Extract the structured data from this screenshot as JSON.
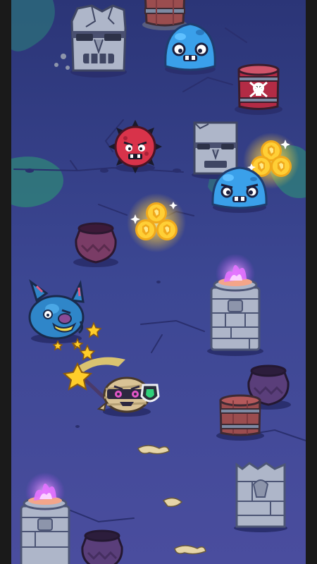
{
  "screen": {
    "type": "game-scene",
    "theme": "night-graveyard",
    "colors": {
      "side_border": "#1a1a1a",
      "ground": "#3f4a96",
      "ground_dark": "#2c3577",
      "moss": "#2f7d7a",
      "stone": "#aab2c5",
      "stone_dark": "#5c6584",
      "barrel": "#9b4d4f",
      "coin": "#ffc933",
      "flame": "#e472ff",
      "slime": "#3aa0ea",
      "spiky": "#d8334a",
      "bat": "#2f86c9",
      "mummy": "#d9c396",
      "star": "#ffcd2a"
    }
  },
  "hero": {
    "character": "mummy",
    "weapon": "star-wand",
    "shield": "green-gem-shield",
    "action": "swinging"
  },
  "enemies": [
    {
      "kind": "stone-tiki",
      "state": "cracked"
    },
    {
      "kind": "blue-slime"
    },
    {
      "kind": "spiky-red-ball"
    },
    {
      "kind": "stone-tiki"
    },
    {
      "kind": "blue-slime"
    },
    {
      "kind": "blue-bat",
      "state": "stunned"
    }
  ],
  "pickups": [
    {
      "kind": "gold-coin-cluster",
      "count": 3
    },
    {
      "kind": "gold-coin-cluster",
      "count": 3
    }
  ],
  "obstacles": [
    {
      "kind": "barrel"
    },
    {
      "kind": "barrel",
      "mark": "skull-and-crossbones"
    },
    {
      "kind": "barrel"
    },
    {
      "kind": "pot"
    },
    {
      "kind": "pot"
    },
    {
      "kind": "pot"
    },
    {
      "kind": "stone-pillar-with-brazier"
    },
    {
      "kind": "stone-pillar-with-brazier"
    },
    {
      "kind": "stone-totem"
    }
  ]
}
